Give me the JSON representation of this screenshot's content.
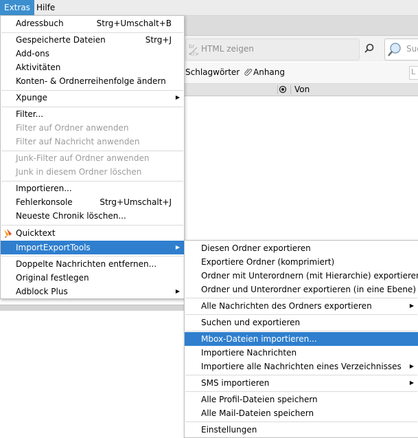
{
  "menubar": {
    "items": [
      {
        "label": "Extras",
        "active": true
      },
      {
        "label": "Hilfe",
        "active": false
      }
    ]
  },
  "background": {
    "html_field": "HTML zeigen",
    "search_placeholder": "Suc",
    "filter_tags": "Schlagwörter",
    "filter_attachment": "Anhang",
    "quick_filter_placeholder": "L",
    "column_from": "Von"
  },
  "extras_menu": {
    "items": [
      {
        "label": "Adressbuch",
        "shortcut": "Strg+Umschalt+B"
      },
      {
        "label": "Gespeicherte Dateien",
        "shortcut": "Strg+J"
      },
      {
        "label": "Add-ons"
      },
      {
        "label": "Aktivitäten"
      },
      {
        "label": "Konten- & Ordnerreihenfolge ändern"
      },
      {
        "label": "Xpunge"
      },
      {
        "label": "Filter..."
      },
      {
        "label": "Filter auf Ordner anwenden"
      },
      {
        "label": "Filter auf Nachricht anwenden"
      },
      {
        "label": "Junk-Filter auf Ordner anwenden"
      },
      {
        "label": "Junk in diesem Ordner löschen"
      },
      {
        "label": "Importieren..."
      },
      {
        "label": "Fehlerkonsole",
        "shortcut": "Strg+Umschalt+J"
      },
      {
        "label": "Neueste Chronik löschen..."
      },
      {
        "label": "Quicktext"
      },
      {
        "label": "ImportExportTools"
      },
      {
        "label": "Doppelte Nachrichten entfernen..."
      },
      {
        "label": "Original festlegen"
      },
      {
        "label": "Adblock Plus"
      }
    ]
  },
  "submenu": {
    "items": [
      {
        "label": "Diesen Ordner exportieren"
      },
      {
        "label": "Exportiere Ordner (komprimiert)"
      },
      {
        "label": "Ordner mit Unterordnern (mit Hierarchie) exportieren"
      },
      {
        "label": "Ordner und Unterordner exportieren (in eine Ebene)"
      },
      {
        "label": "Alle Nachrichten des Ordners exportieren"
      },
      {
        "label": "Suchen und exportieren"
      },
      {
        "label": "Mbox-Dateien importieren..."
      },
      {
        "label": "Importiere Nachrichten"
      },
      {
        "label": "Importiere alle Nachrichten eines Verzeichnisses"
      },
      {
        "label": "SMS importieren"
      },
      {
        "label": "Alle Profil-Dateien speichern"
      },
      {
        "label": "Alle Mail-Dateien speichern"
      },
      {
        "label": "Einstellungen"
      }
    ]
  },
  "colors": {
    "highlight": "#2f7fce",
    "menubar_active": "#3c8fcf",
    "disabled_text": "#9c9c9c"
  }
}
